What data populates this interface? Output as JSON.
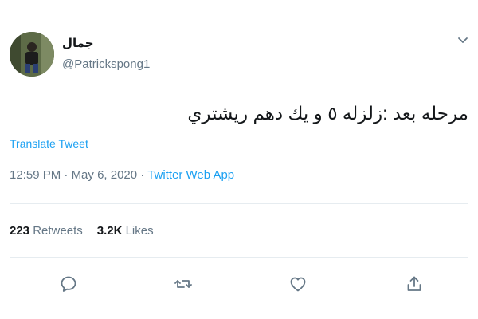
{
  "author": {
    "name": "جمال",
    "handle": "@Patrickspong1",
    "avatar_icon": "profile-photo"
  },
  "tweet": {
    "text": "مرحله بعد :زلزله ٥ و يك دهم ريشتري",
    "translate_label": "Translate Tweet"
  },
  "meta": {
    "time": "12:59 PM",
    "separator1": " · ",
    "date": "May 6, 2020",
    "separator2": " · ",
    "source": "Twitter Web App"
  },
  "stats": {
    "retweets_count": "223",
    "retweets_label": "Retweets",
    "likes_count": "3.2K",
    "likes_label": "Likes"
  },
  "actions": {
    "reply_icon": "reply-icon",
    "retweet_icon": "retweet-icon",
    "like_icon": "heart-icon",
    "share_icon": "share-icon"
  },
  "colors": {
    "accent": "#1da1f2",
    "secondary_text": "#657786",
    "primary_text": "#14171a",
    "divider": "#e6ecf0"
  }
}
